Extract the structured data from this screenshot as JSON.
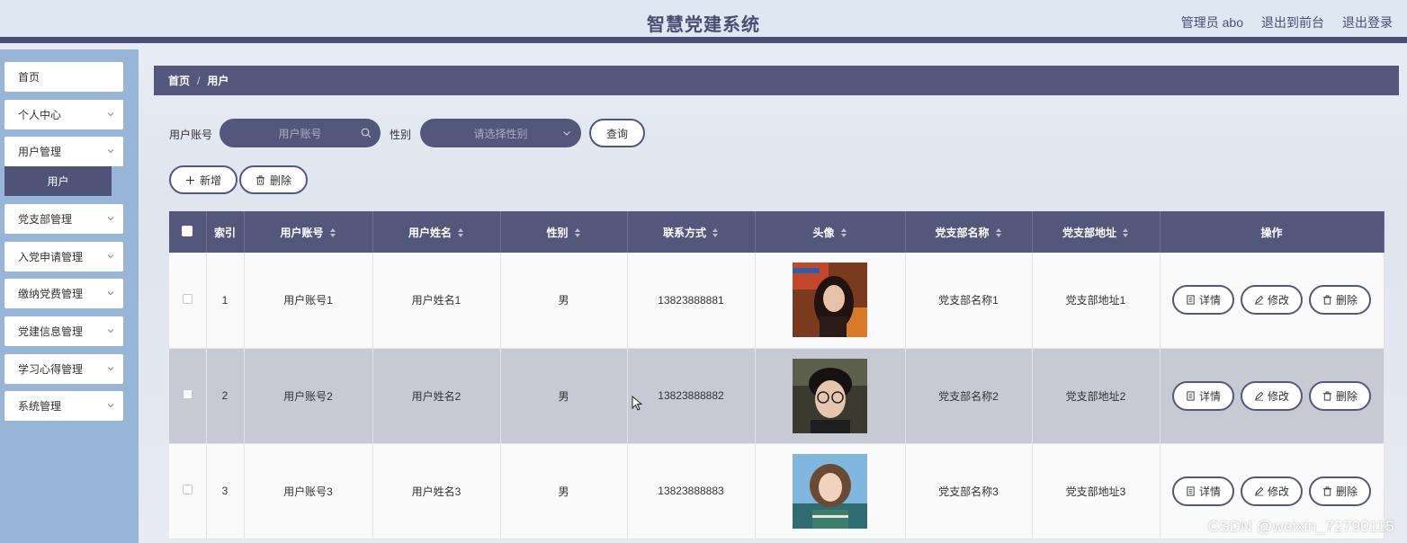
{
  "header": {
    "title": "智慧党建系统",
    "user_label": "管理员 abo",
    "front_link": "退出到前台",
    "logout_link": "退出登录"
  },
  "sidebar": {
    "items": [
      {
        "label": "首页",
        "has_arrow": false
      },
      {
        "label": "个人中心",
        "has_arrow": true
      },
      {
        "label": "用户管理",
        "has_arrow": true,
        "expanded": true
      },
      {
        "label": "党支部管理",
        "has_arrow": true
      },
      {
        "label": "入党申请管理",
        "has_arrow": true
      },
      {
        "label": "缴纳党费管理",
        "has_arrow": true
      },
      {
        "label": "党建信息管理",
        "has_arrow": true
      },
      {
        "label": "学习心得管理",
        "has_arrow": true
      },
      {
        "label": "系统管理",
        "has_arrow": true
      }
    ],
    "active_subitem": "用户"
  },
  "breadcrumb": {
    "home": "首页",
    "separator": "/",
    "current": "用户"
  },
  "search": {
    "account_label": "用户账号",
    "account_placeholder": "用户账号",
    "gender_label": "性别",
    "gender_placeholder": "请选择性别",
    "query_button": "查询"
  },
  "actions": {
    "add": "新增",
    "delete": "删除"
  },
  "table": {
    "columns": [
      "索引",
      "用户账号",
      "用户姓名",
      "性别",
      "联系方式",
      "头像",
      "党支部名称",
      "党支部地址",
      "操作"
    ],
    "rows": [
      {
        "index": "1",
        "account": "用户账号1",
        "name": "用户姓名1",
        "gender": "男",
        "phone": "13823888881",
        "branch": "党支部名称1",
        "address": "党支部地址1"
      },
      {
        "index": "2",
        "account": "用户账号2",
        "name": "用户姓名2",
        "gender": "男",
        "phone": "13823888882",
        "branch": "党支部名称2",
        "address": "党支部地址2"
      },
      {
        "index": "3",
        "account": "用户账号3",
        "name": "用户姓名3",
        "gender": "男",
        "phone": "13823888883",
        "branch": "党支部名称3",
        "address": "党支部地址3"
      }
    ],
    "row_actions": {
      "detail": "详情",
      "edit": "修改",
      "delete": "删除"
    }
  },
  "watermark": "CSDN @weixin_72790115",
  "colors": {
    "primary": "#53577c",
    "sidebar": "#96b5d7",
    "header": "#dde8f3",
    "highlight_row": "#c8cad3"
  }
}
